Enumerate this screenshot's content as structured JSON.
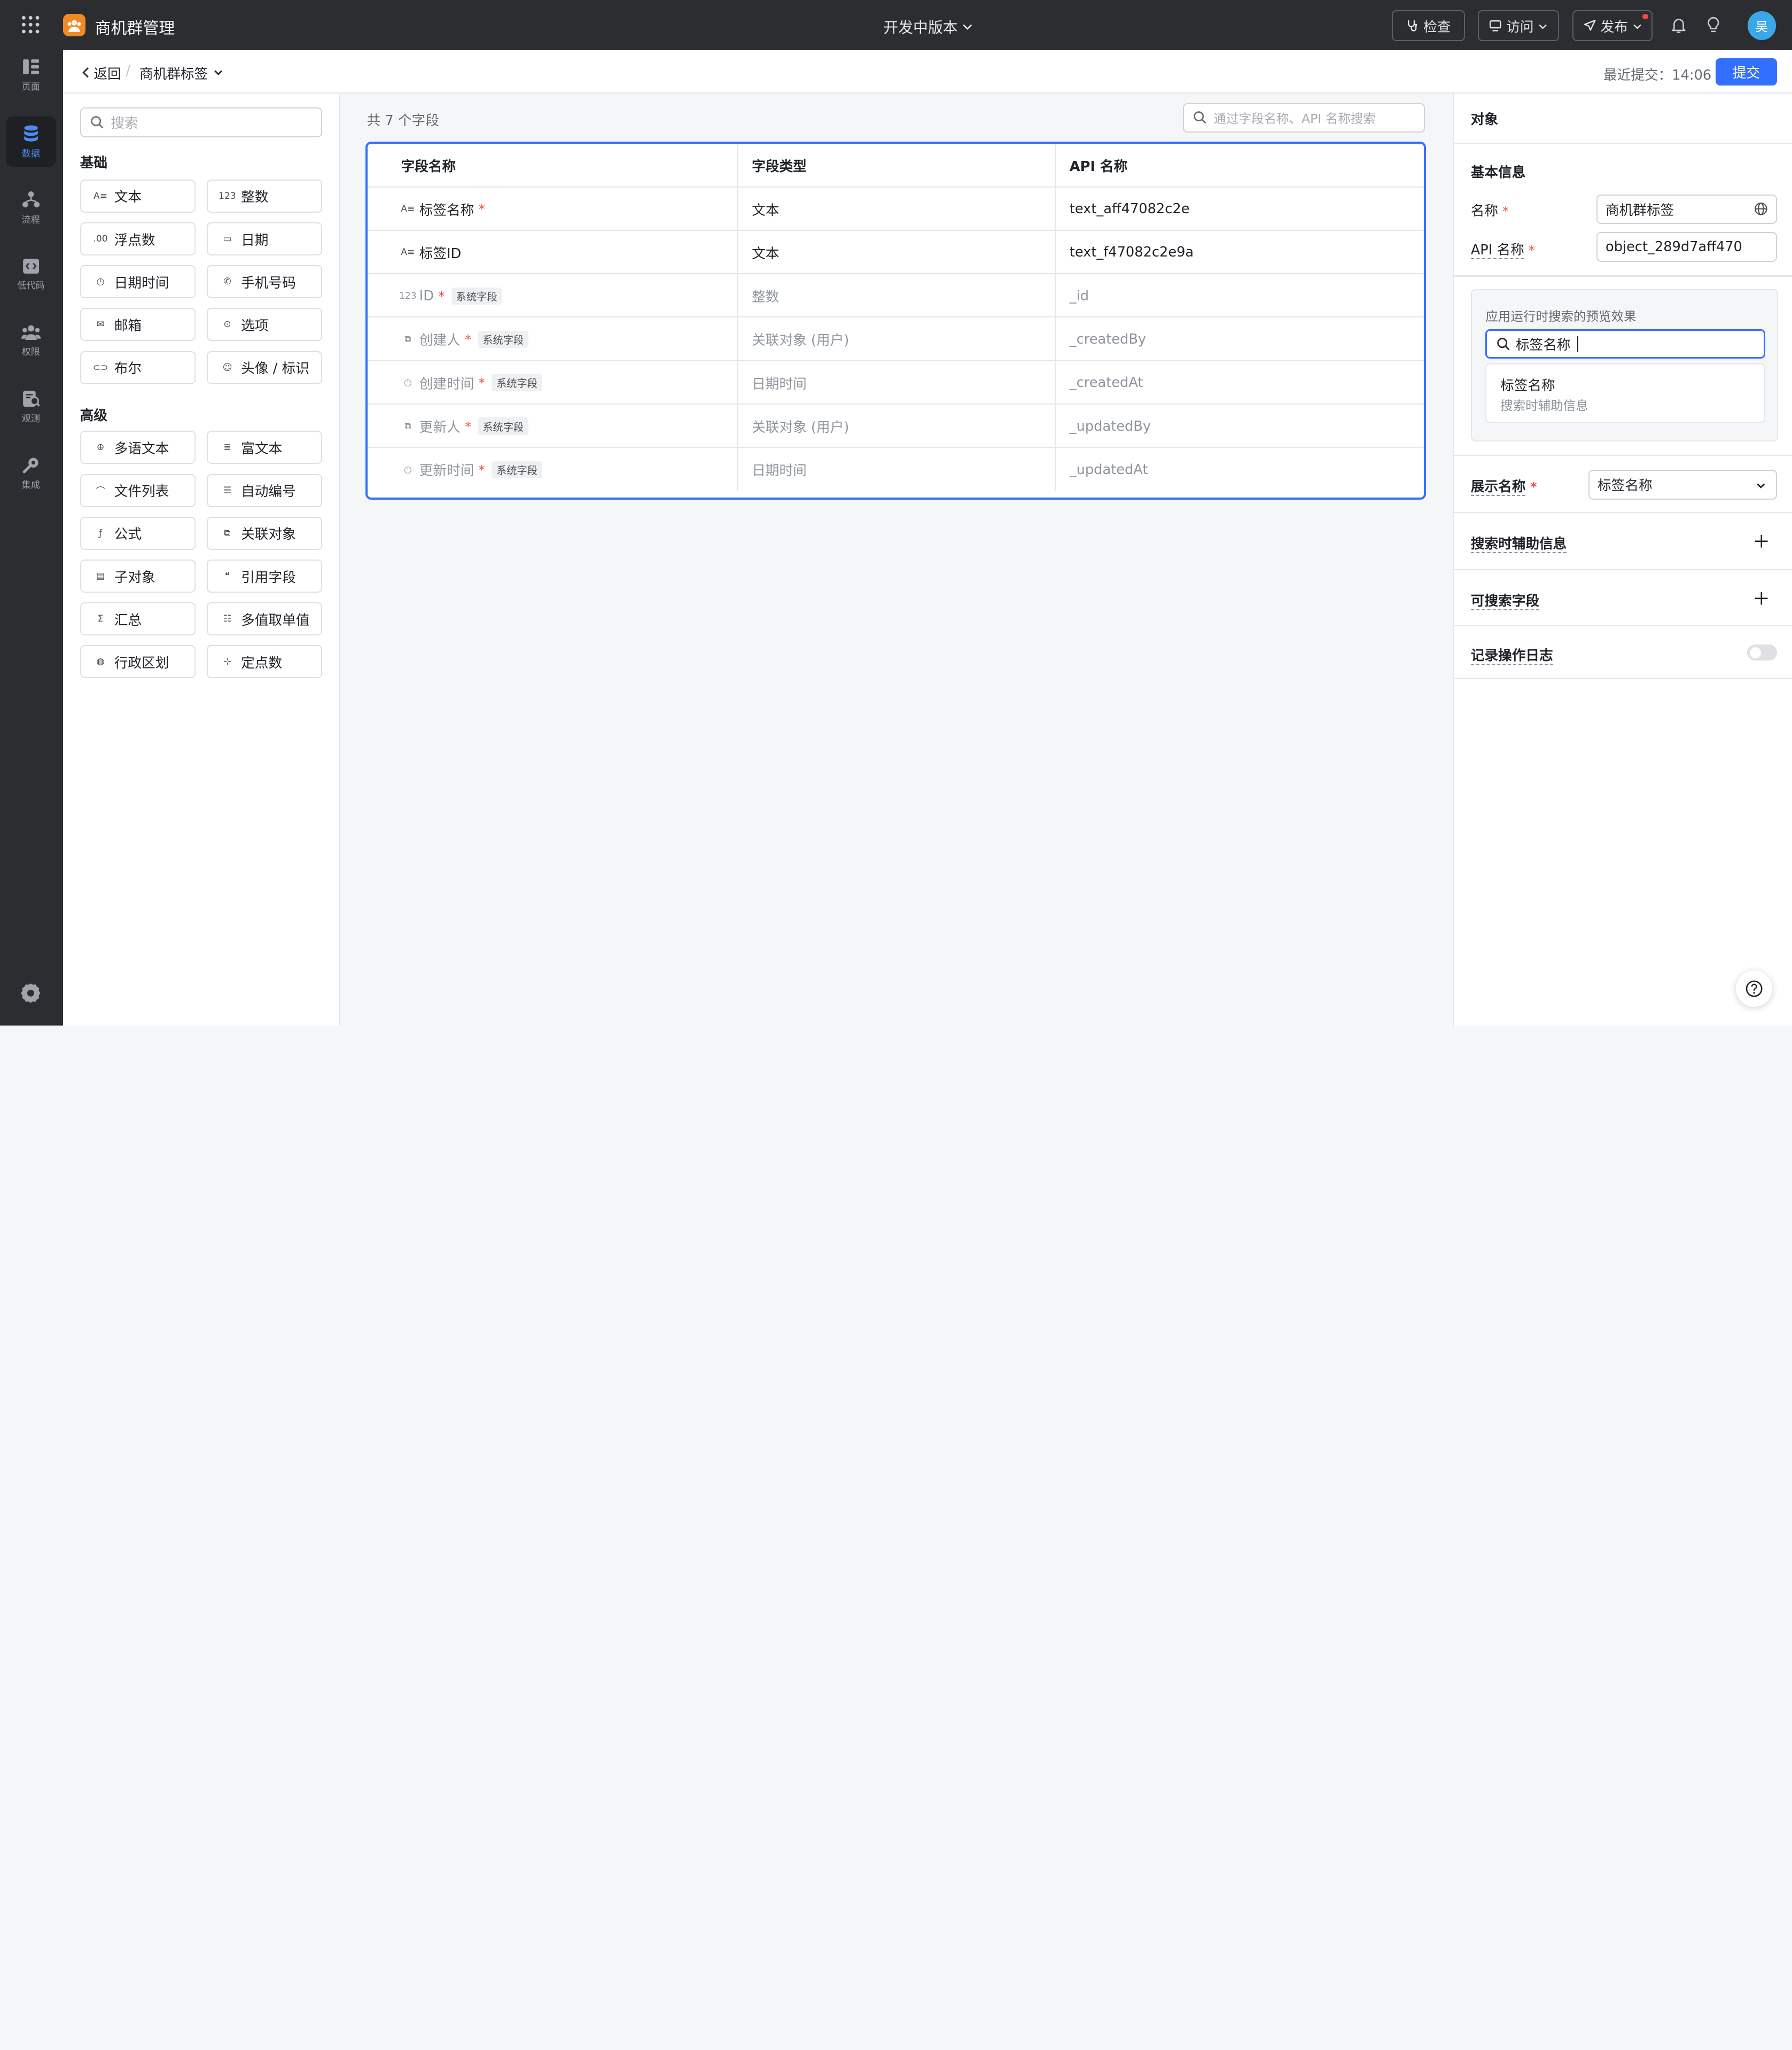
{
  "topbar": {
    "app_name": "商机群管理",
    "version": "开发中版本",
    "check_label": "检查",
    "visit_label": "访问",
    "publish_label": "发布",
    "avatar_text": "吴",
    "colors": {
      "bg": "#2b2d31",
      "accent": "#3370ff",
      "app_icon": "#f08a24",
      "avatar": "#3aa8e8"
    }
  },
  "nav": {
    "items": [
      {
        "label": "页面",
        "icon": "pages-icon"
      },
      {
        "label": "数据",
        "icon": "database-icon",
        "active": true
      },
      {
        "label": "流程",
        "icon": "flow-icon"
      },
      {
        "label": "低代码",
        "icon": "code-icon"
      },
      {
        "label": "权限",
        "icon": "permission-icon"
      },
      {
        "label": "观测",
        "icon": "observe-icon"
      },
      {
        "label": "集成",
        "icon": "integration-icon"
      }
    ]
  },
  "header": {
    "back_label": "返回",
    "object_name": "商机群标签",
    "last_submit": "最近提交：14:06",
    "submit_label": "提交"
  },
  "palette": {
    "search_placeholder": "搜索",
    "basic_title": "基础",
    "basic": [
      {
        "label": "文本",
        "icon": "A≡"
      },
      {
        "label": "整数",
        "icon": "123"
      },
      {
        "label": "浮点数",
        "icon": ".00"
      },
      {
        "label": "日期",
        "icon": "▭"
      },
      {
        "label": "日期时间",
        "icon": "◷"
      },
      {
        "label": "手机号码",
        "icon": "✆"
      },
      {
        "label": "邮箱",
        "icon": "✉"
      },
      {
        "label": "选项",
        "icon": "⊙"
      },
      {
        "label": "布尔",
        "icon": "⊂⊃"
      },
      {
        "label": "头像 / 标识",
        "icon": "☺"
      }
    ],
    "advanced_title": "高级",
    "advanced": [
      {
        "label": "多语文本",
        "icon": "⊕"
      },
      {
        "label": "富文本",
        "icon": "≣"
      },
      {
        "label": "文件列表",
        "icon": "⌒"
      },
      {
        "label": "自动编号",
        "icon": "☰"
      },
      {
        "label": "公式",
        "icon": "ƒ"
      },
      {
        "label": "关联对象",
        "icon": "⧉"
      },
      {
        "label": "子对象",
        "icon": "▤"
      },
      {
        "label": "引用字段",
        "icon": "❝"
      },
      {
        "label": "汇总",
        "icon": "Σ"
      },
      {
        "label": "多值取单值",
        "icon": "☷"
      },
      {
        "label": "行政区划",
        "icon": "◍"
      },
      {
        "label": "定点数",
        "icon": "⊹"
      }
    ]
  },
  "fields": {
    "count_text": "共 7 个字段",
    "search_placeholder": "通过字段名称、API 名称搜索",
    "columns": [
      "字段名称",
      "字段类型",
      "API 名称"
    ],
    "system_badge": "系统字段",
    "rows": [
      {
        "name": "标签名称",
        "icon": "A≡",
        "required": true,
        "system": false,
        "type": "文本",
        "api": "text_aff47082c2e"
      },
      {
        "name": "标签ID",
        "icon": "A≡",
        "required": false,
        "system": false,
        "type": "文本",
        "api": "text_f47082c2e9a"
      },
      {
        "name": "ID",
        "icon": "123",
        "required": true,
        "system": true,
        "type": "整数",
        "api": "_id"
      },
      {
        "name": "创建人",
        "icon": "⧉",
        "required": true,
        "system": true,
        "type": "关联对象 (用户)",
        "api": "_createdBy"
      },
      {
        "name": "创建时间",
        "icon": "◷",
        "required": true,
        "system": true,
        "type": "日期时间",
        "api": "_createdAt"
      },
      {
        "name": "更新人",
        "icon": "⧉",
        "required": true,
        "system": true,
        "type": "关联对象 (用户)",
        "api": "_updatedBy"
      },
      {
        "name": "更新时间",
        "icon": "◷",
        "required": true,
        "system": true,
        "type": "日期时间",
        "api": "_updatedAt"
      }
    ]
  },
  "panel": {
    "title": "对象",
    "basic_info": "基本信息",
    "name_label": "名称",
    "name_value": "商机群标签",
    "api_label": "API 名称",
    "api_value": "object_289d7aff470",
    "preview_label": "应用运行时搜索的预览效果",
    "preview_input": "标签名称",
    "preview_option": "标签名称",
    "preview_option_sub": "搜索时辅助信息",
    "display_label": "展示名称",
    "display_value": "标签名称",
    "aux_label": "搜索时辅助信息",
    "searchable_label": "可搜索字段",
    "log_label": "记录操作日志",
    "log_enabled": false
  }
}
